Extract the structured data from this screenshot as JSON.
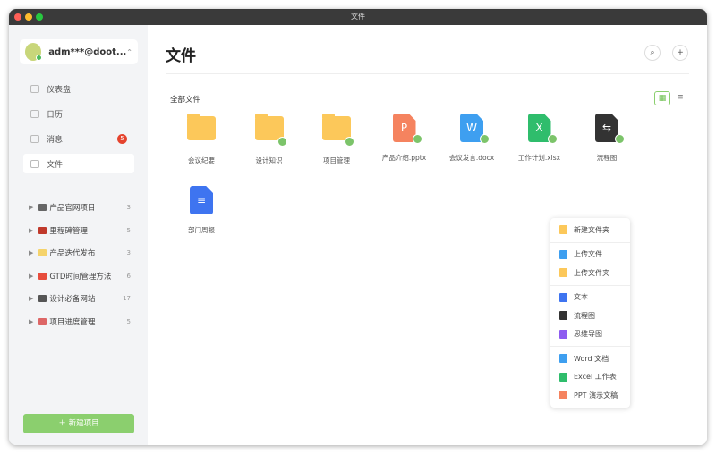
{
  "window": {
    "title": "文件"
  },
  "account": {
    "name": "adm***@doot..."
  },
  "nav": [
    {
      "label": "仪表盘"
    },
    {
      "label": "日历"
    },
    {
      "label": "消息",
      "badge": "5"
    },
    {
      "label": "文件"
    }
  ],
  "projects": [
    {
      "label": "产品官网项目",
      "count": "3",
      "color": "#666"
    },
    {
      "label": "里程碑管理",
      "count": "5",
      "color": "#c0392b"
    },
    {
      "label": "产品迭代发布",
      "count": "3",
      "color": "#f5d36b"
    },
    {
      "label": "GTD时间管理方法",
      "count": "6",
      "color": "#e74c3c"
    },
    {
      "label": "设计必备网站",
      "count": "17",
      "color": "#555"
    },
    {
      "label": "项目进度管理",
      "count": "5",
      "color": "#d66"
    }
  ],
  "new_project": "＋ 新建项目",
  "main": {
    "title": "文件",
    "breadcrumb": "全部文件",
    "search_icon": "⌕",
    "add_icon": "+",
    "grid_icon": "▦",
    "list_icon": "≡"
  },
  "files": [
    {
      "name": "会议纪要",
      "type": "folder",
      "shared": false
    },
    {
      "name": "设计知识",
      "type": "folder",
      "shared": true
    },
    {
      "name": "项目管理",
      "type": "folder",
      "shared": true
    },
    {
      "name": "产品介绍.pptx",
      "type": "ppt",
      "letter": "P",
      "color": "#f5835f",
      "shared": true
    },
    {
      "name": "会议发言.docx",
      "type": "word",
      "letter": "W",
      "color": "#3e9ff0",
      "shared": true
    },
    {
      "name": "工作计划.xlsx",
      "type": "excel",
      "letter": "X",
      "color": "#2fbd6c",
      "shared": true
    },
    {
      "name": "流程图",
      "type": "flow",
      "letter": "⇆",
      "color": "#333",
      "shared": true
    },
    {
      "name": "部门周报",
      "type": "text",
      "letter": "≡",
      "color": "#3e74f0",
      "shared": false
    }
  ],
  "menu": [
    [
      {
        "label": "新建文件夹",
        "color": "#fcc85a"
      }
    ],
    [
      {
        "label": "上传文件",
        "color": "#3e9ff0"
      },
      {
        "label": "上传文件夹",
        "color": "#fcc85a"
      }
    ],
    [
      {
        "label": "文本",
        "color": "#3e74f0"
      },
      {
        "label": "流程图",
        "color": "#333"
      },
      {
        "label": "思维导图",
        "color": "#8e5cf0"
      }
    ],
    [
      {
        "label": "Word 文档",
        "color": "#3e9ff0"
      },
      {
        "label": "Excel 工作表",
        "color": "#2fbd6c"
      },
      {
        "label": "PPT 演示文稿",
        "color": "#f5835f"
      }
    ]
  ]
}
